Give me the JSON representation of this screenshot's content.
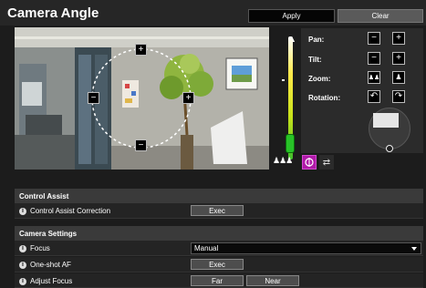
{
  "header": {
    "title": "Camera Angle",
    "apply_label": "Apply",
    "clear_label": "Clear"
  },
  "ptz": {
    "pan_label": "Pan:",
    "tilt_label": "Tilt:",
    "zoom_label": "Zoom:",
    "rotation_label": "Rotation:"
  },
  "control_assist": {
    "section_title": "Control Assist",
    "correction_label": "Control Assist Correction",
    "exec_label": "Exec"
  },
  "camera_settings": {
    "section_title": "Camera Settings",
    "focus_label": "Focus",
    "focus_value": "Manual",
    "oneshot_label": "One-shot AF",
    "oneshot_exec": "Exec",
    "adjust_label": "Adjust Focus",
    "far_label": "Far",
    "near_label": "Near"
  }
}
